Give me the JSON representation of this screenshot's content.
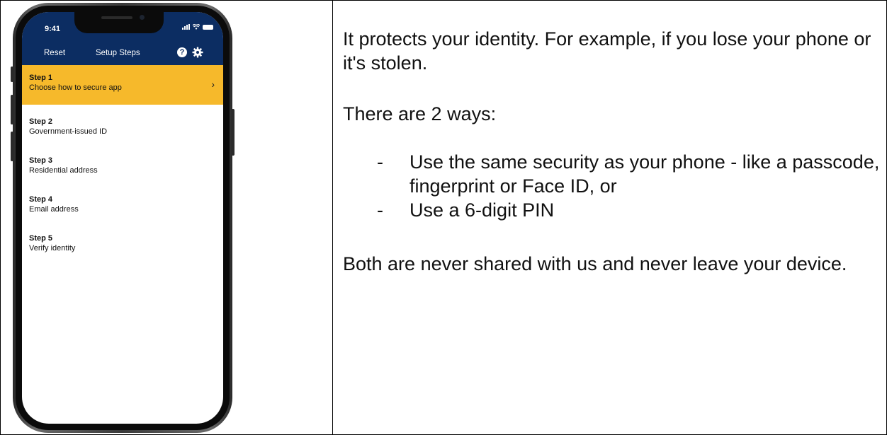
{
  "phone": {
    "status_time": "9:41",
    "nav": {
      "reset_label": "Reset",
      "title": "Setup Steps",
      "help_icon": "help-circle-icon",
      "settings_icon": "gear-icon"
    },
    "steps": [
      {
        "num": "Step 1",
        "desc": "Choose how to secure app",
        "active": true
      },
      {
        "num": "Step 2",
        "desc": "Government-issued ID"
      },
      {
        "num": "Step 3",
        "desc": "Residential address"
      },
      {
        "num": "Step 4",
        "desc": "Email address"
      },
      {
        "num": "Step 5",
        "desc": "Verify identity"
      }
    ],
    "colors": {
      "header": "#0c2d62",
      "active_step": "#f6b92b"
    }
  },
  "content": {
    "p1": "It protects your identity. For example, if you lose your phone or it's stolen.",
    "p2": "There are 2 ways:",
    "ways": [
      "Use the same security as your phone - like a passcode, fingerprint or Face ID, or",
      "Use a 6-digit PIN"
    ],
    "bullet": "-",
    "p3": "Both are never shared with us and never leave your device."
  }
}
